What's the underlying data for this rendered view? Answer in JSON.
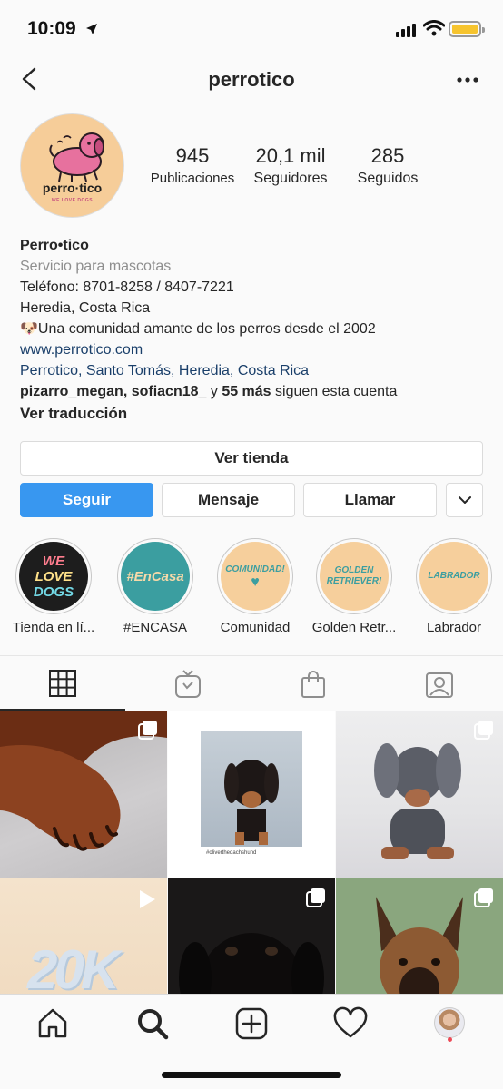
{
  "status_bar": {
    "time": "10:09"
  },
  "header": {
    "username": "perrotico"
  },
  "avatar": {
    "brand_name": "perro·tico",
    "brand_tagline": "WE LOVE DOGS"
  },
  "stats": [
    {
      "value": "945",
      "label": "Publicaciones"
    },
    {
      "value": "20,1 mil",
      "label": "Seguidores"
    },
    {
      "value": "285",
      "label": "Seguidos"
    }
  ],
  "bio": {
    "name": "Perro•tico",
    "category": "Servicio para mascotas",
    "phone": "Teléfono: 8701-8258 / 8407-7221",
    "location_text": "Heredia, Costa Rica",
    "description": "🐶Una comunidad amante de los perros desde el 2002",
    "website": "www.perrotico.com",
    "address_link": "Perrotico, Santo Tomás, Heredia, Costa Rica",
    "followed_by_names": "pizarro_megan, sofiacn18_",
    "followed_by_and": " y ",
    "followed_by_more": "55 más",
    "followed_by_suffix": " siguen esta cuenta",
    "translate": "Ver traducción"
  },
  "buttons": {
    "shop": "Ver tienda",
    "follow": "Seguir",
    "message": "Mensaje",
    "call": "Llamar"
  },
  "highlights": [
    {
      "label": "Tienda en lí...",
      "cover_words": [
        "WE",
        "LOVE",
        "DOGS"
      ]
    },
    {
      "label": "#ENCASA",
      "cover_text": "#EnCasa"
    },
    {
      "label": "Comunidad",
      "cover_text": "COMUNIDAD!"
    },
    {
      "label": "Golden Retr...",
      "cover_words": [
        "GOLDEN",
        "RETRIEVER!"
      ]
    },
    {
      "label": "Labrador",
      "cover_text": "LABRADOR"
    }
  ],
  "grid": {
    "post_4_overlay": "20K",
    "post_2_caption": "#oliverthedachshund"
  },
  "colors": {
    "follow_button": "#3897f0",
    "link": "#1a3f6a",
    "notification_dot": "#ed4956",
    "highlight_teal": "#3b9ea0",
    "highlight_peach": "#f6cf9c"
  },
  "icons": {
    "tabs": [
      "grid-icon",
      "igtv-icon",
      "shopping-bag-icon",
      "tagged-icon"
    ],
    "bottom_nav": [
      "home-icon",
      "search-icon",
      "add-post-icon",
      "heart-icon",
      "profile-avatar"
    ]
  }
}
